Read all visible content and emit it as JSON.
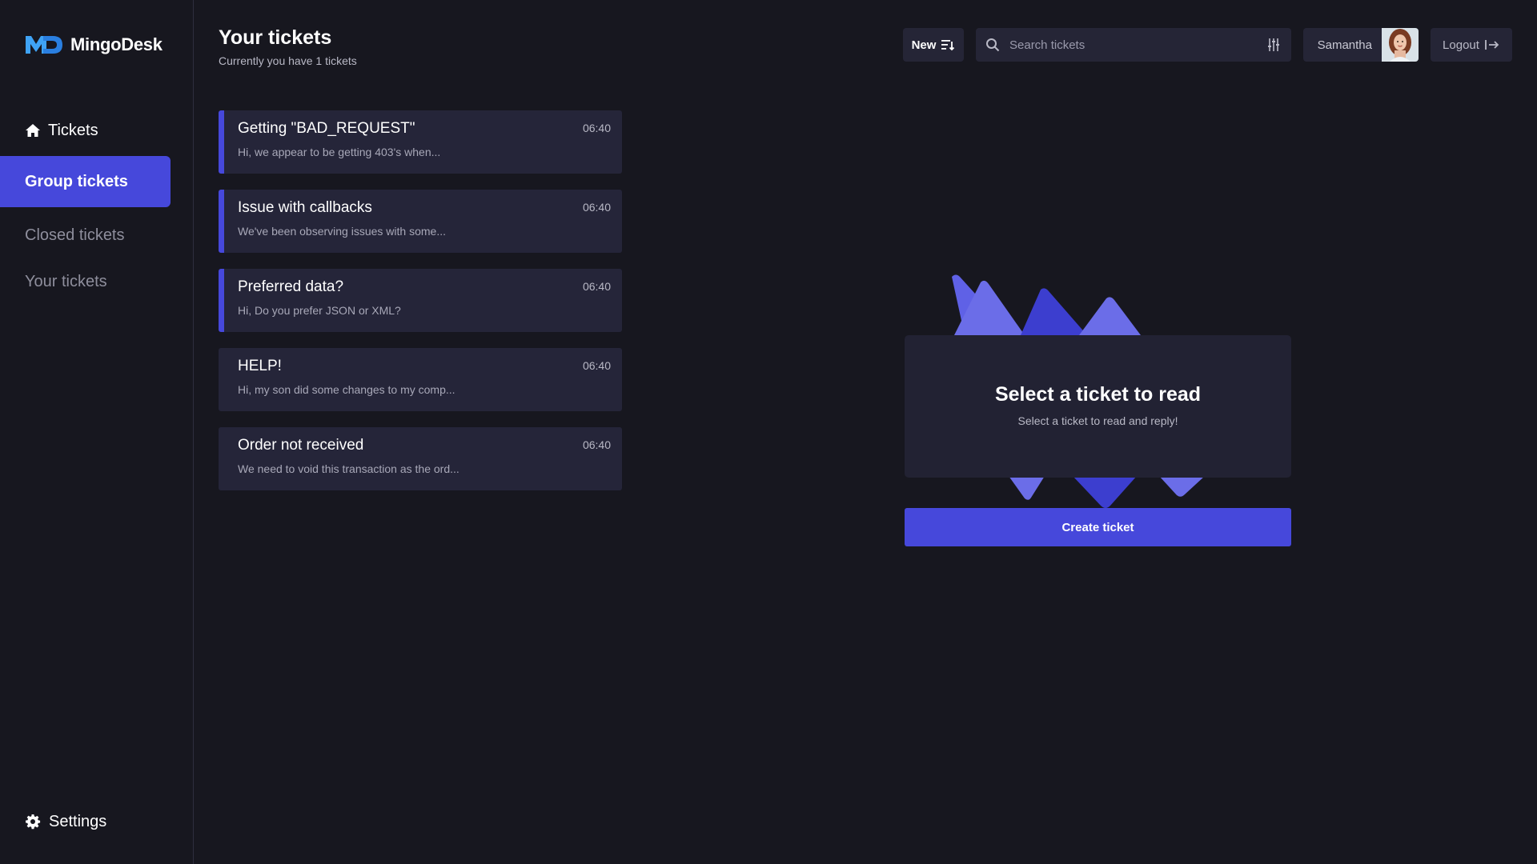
{
  "app": {
    "brand": "MingoDesk",
    "accent_color": "#4648db"
  },
  "sidebar": {
    "items": [
      {
        "label": "Tickets",
        "icon": "home-icon"
      },
      {
        "label": "Group tickets"
      },
      {
        "label": "Closed tickets"
      },
      {
        "label": "Your tickets"
      }
    ],
    "active_item": "Group tickets",
    "settings": {
      "label": "Settings",
      "icon": "gear-icon"
    }
  },
  "header": {
    "title": "Your tickets",
    "subtitle": "Currently you have 1 tickets",
    "sort_label": "New",
    "search_placeholder": "Search tickets",
    "user_name": "Samantha",
    "logout_label": "Logout"
  },
  "tickets": [
    {
      "title": "Getting \"BAD_REQUEST\"",
      "preview": "Hi, we appear to be getting 403's when...",
      "time": "06:40",
      "unread": true
    },
    {
      "title": "Issue with callbacks",
      "preview": "We've been observing issues with some...",
      "time": "06:40",
      "unread": true
    },
    {
      "title": "Preferred data?",
      "preview": "Hi, Do you prefer JSON or XML?",
      "time": "06:40",
      "unread": true
    },
    {
      "title": "HELP!",
      "preview": "Hi, my son did some changes to my comp...",
      "time": "06:40",
      "unread": false
    },
    {
      "title": "Order not received",
      "preview": "We need to void this transaction as the ord...",
      "time": "06:40",
      "unread": false
    }
  ],
  "empty_state": {
    "title": "Select a ticket to read",
    "subtitle": "Select a ticket to read and reply!",
    "create_label": "Create ticket"
  }
}
